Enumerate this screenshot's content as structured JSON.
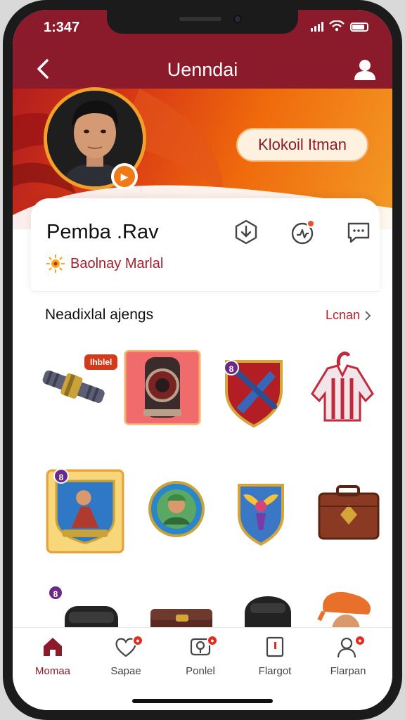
{
  "status_bar": {
    "time": "1:347"
  },
  "header": {
    "title": "Uenndai"
  },
  "banner": {
    "button_label": "Klokoil  Itman"
  },
  "profile": {
    "name": "Pemba .Rav",
    "status": "Baolnay Marlal"
  },
  "section": {
    "title": "Neadixlal ajengs",
    "link_label": "Lcnan"
  },
  "items": [
    {
      "name": "item-mechanical-tube",
      "tag": "Ihblel"
    },
    {
      "name": "item-armor-canister"
    },
    {
      "name": "item-dragon-shield",
      "count": "8"
    },
    {
      "name": "item-red-jacket"
    },
    {
      "name": "item-warrior-card",
      "count": "8"
    },
    {
      "name": "item-portrait-coin"
    },
    {
      "name": "item-winged-emblem"
    },
    {
      "name": "item-leather-chest"
    },
    {
      "name": "item-dark-pack",
      "count": "8"
    },
    {
      "name": "item-brown-case"
    },
    {
      "name": "item-black-backpack"
    },
    {
      "name": "item-orange-hat-figure"
    }
  ],
  "nav": [
    {
      "label": "Momaa",
      "icon": "home-icon"
    },
    {
      "label": "Sapae",
      "icon": "heart-icon"
    },
    {
      "label": "Ponlel",
      "icon": "wrench-icon"
    },
    {
      "label": "Flargot",
      "icon": "flag-icon"
    },
    {
      "label": "Flarpan",
      "icon": "user-icon"
    }
  ],
  "colors": {
    "brand": "#8b1a2b",
    "accent": "#f07a18",
    "status_text": "#a71d2a"
  }
}
